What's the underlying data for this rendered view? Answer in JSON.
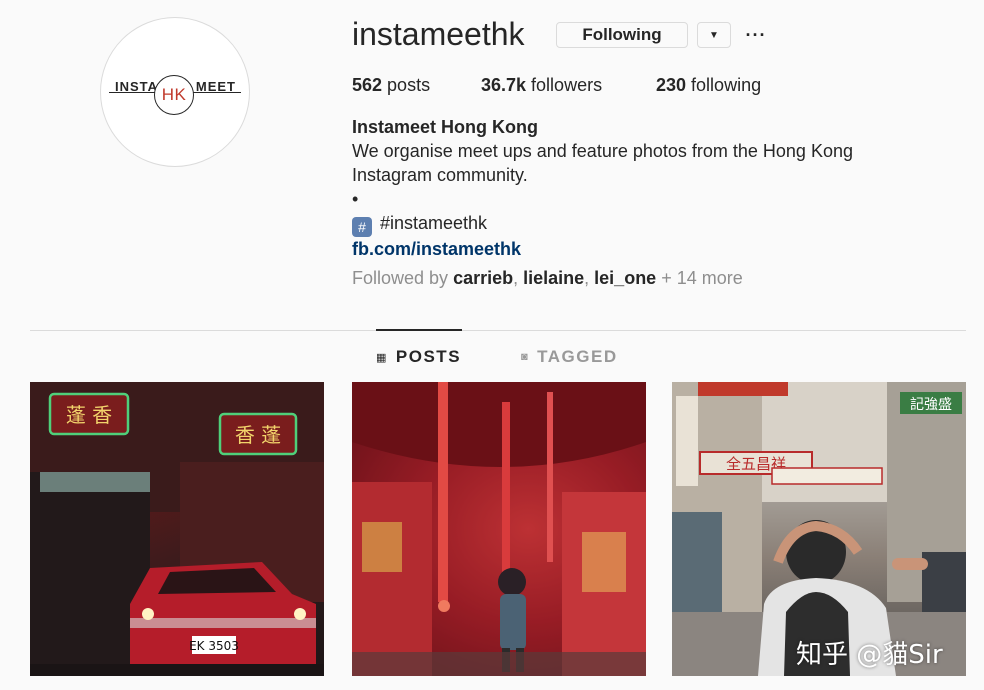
{
  "profile": {
    "username": "instameethk",
    "following_label": "Following",
    "dropdown_icon": "caret-down-icon",
    "more_icon": "ellipsis-icon",
    "avatar_logo_left": "INSTA",
    "avatar_logo_center": "HK",
    "avatar_logo_right": "MEET"
  },
  "stats": {
    "posts_count": "562",
    "posts_label": " posts",
    "followers_count": "36.7k",
    "followers_label": " followers",
    "following_count": "230",
    "following_label": " following"
  },
  "bio": {
    "full_name": "Instameet Hong Kong",
    "line1": "We organise meet ups and feature photos from the Hong Kong",
    "line2": "Instagram community.",
    "bullet": "•",
    "hashtag_icon": "#️⃣",
    "hashtag": "#instameethk",
    "link": "fb.com/instameethk"
  },
  "followed_by": {
    "prefix": "Followed by ",
    "users": [
      "carrieb",
      "lielaine",
      "lei_one"
    ],
    "more": " + 14 more"
  },
  "tabs": [
    {
      "label": "POSTS",
      "icon": "grid-icon",
      "active": true
    },
    {
      "label": "TAGGED",
      "icon": "tag-icon",
      "active": false
    }
  ],
  "posts": [
    {
      "alt": "Red neon signs and red taxi"
    },
    {
      "alt": "Red lantern market"
    },
    {
      "alt": "Street signs and photographer"
    }
  ],
  "tile1_text": {
    "plate": "EK 3503",
    "sign1": "蓬 香",
    "sign2": "香 蓬"
  },
  "tile3_text": {
    "sign1": "全五昌祥",
    "sign2": "記強盛"
  },
  "watermark": "知乎 @貓Sir",
  "colors": {
    "link": "#003569",
    "muted": "#8e8e8e",
    "text": "#262626",
    "border": "#dbdbdb"
  }
}
